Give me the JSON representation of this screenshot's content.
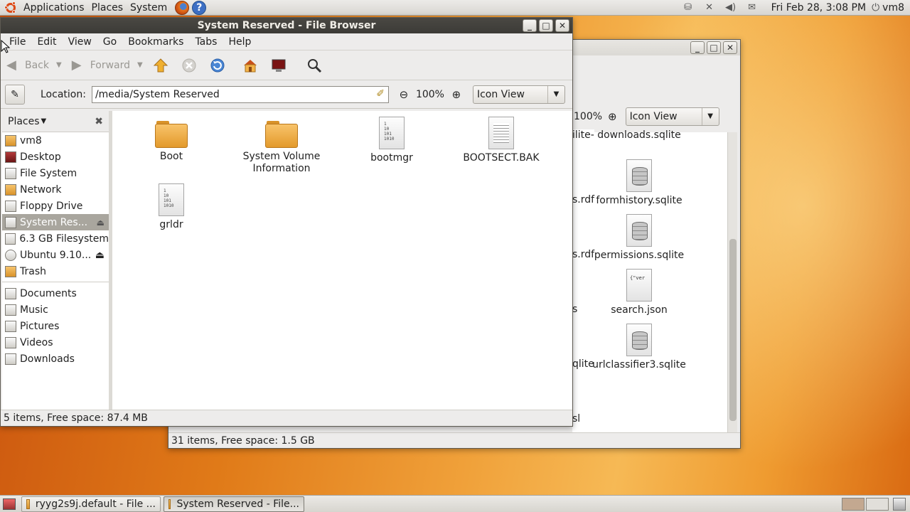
{
  "top_panel": {
    "menus": [
      "Applications",
      "Places",
      "System"
    ],
    "clock": "Fri Feb 28,  3:08 PM",
    "user": "vm8"
  },
  "bg_window": {
    "zoom": "100%",
    "view": "Icon View",
    "partial_left": [
      "ilite-",
      "s.rdf",
      "s.rdf",
      "s",
      "qlite",
      "sl"
    ],
    "files": [
      {
        "name": "downloads.sqlite",
        "icon": "database-icon"
      },
      {
        "name": "formhistory.sqlite",
        "icon": "database-icon"
      },
      {
        "name": "permissions.sqlite",
        "icon": "database-icon"
      },
      {
        "name": "search.json",
        "icon": "json-file-icon"
      },
      {
        "name": "urlclassifier3.sqlite",
        "icon": "database-icon"
      }
    ],
    "json_preview": "{\"ver",
    "status": "31 items, Free space: 1.5 GB"
  },
  "main_window": {
    "title": "System Reserved - File Browser",
    "menu": [
      "File",
      "Edit",
      "View",
      "Go",
      "Bookmarks",
      "Tabs",
      "Help"
    ],
    "toolbar": {
      "back": "Back",
      "forward": "Forward"
    },
    "location_label": "Location:",
    "location_value": "/media/System Reserved",
    "zoom": "100%",
    "view": "Icon View",
    "places_label": "Places",
    "places": [
      {
        "label": "vm8",
        "icon": "home-folder-icon"
      },
      {
        "label": "Desktop",
        "icon": "desktop-icon"
      },
      {
        "label": "File System",
        "icon": "harddisk-icon"
      },
      {
        "label": "Network",
        "icon": "network-icon"
      },
      {
        "label": "Floppy Drive",
        "icon": "floppy-icon"
      },
      {
        "label": "System Res...",
        "icon": "drive-icon",
        "selected": true,
        "eject": true
      },
      {
        "label": "6.3 GB Filesystem",
        "icon": "drive-icon"
      },
      {
        "label": "Ubuntu 9.10...",
        "icon": "cdrom-icon",
        "eject": true
      },
      {
        "label": "Trash",
        "icon": "trash-icon"
      }
    ],
    "bookmarks": [
      {
        "label": "Documents",
        "icon": "folder-icon"
      },
      {
        "label": "Music",
        "icon": "music-folder-icon"
      },
      {
        "label": "Pictures",
        "icon": "pictures-folder-icon"
      },
      {
        "label": "Videos",
        "icon": "videos-folder-icon"
      },
      {
        "label": "Downloads",
        "icon": "downloads-folder-icon"
      }
    ],
    "files": [
      {
        "name": "Boot",
        "type": "folder"
      },
      {
        "name": "System Volume Information",
        "type": "folder"
      },
      {
        "name": "bootmgr",
        "type": "binary"
      },
      {
        "name": "BOOTSECT.BAK",
        "type": "text"
      },
      {
        "name": "grldr",
        "type": "binary"
      }
    ],
    "binary_preview": "1\n10\n101\n1010",
    "status": "5 items, Free space: 87.4 MB"
  },
  "taskbar": {
    "tasks": [
      {
        "label": "ryyg2s9j.default - File ...",
        "active": false
      },
      {
        "label": "System Reserved - File...",
        "active": true
      }
    ]
  }
}
